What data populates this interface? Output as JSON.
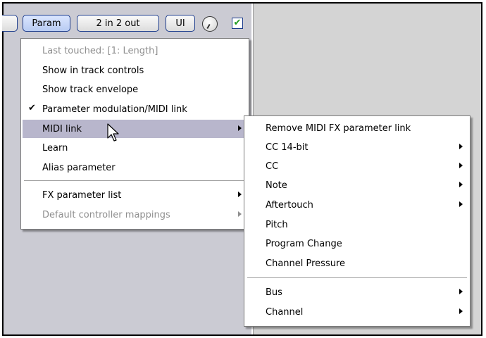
{
  "toolbar": {
    "param_label": "Param",
    "io_label": "2 in 2 out",
    "ui_label": "UI",
    "knob_icon": "knob-icon",
    "checkbox_mark": "✔"
  },
  "context_menu": {
    "last_touched": "Last touched: [1: Length]",
    "show_track_controls": "Show in track controls",
    "show_track_envelope": "Show track envelope",
    "param_modulation": "Parameter modulation/MIDI link",
    "param_modulation_check": "✔",
    "midi_link": "MIDI link",
    "learn": "Learn",
    "alias_parameter": "Alias parameter",
    "fx_parameter_list": "FX parameter list",
    "default_controller_mappings": "Default controller mappings"
  },
  "midi_submenu": {
    "remove_link": "Remove MIDI FX parameter link",
    "cc14": "CC 14-bit",
    "cc": "CC",
    "note": "Note",
    "aftertouch": "Aftertouch",
    "pitch": "Pitch",
    "program_change": "Program Change",
    "channel_pressure": "Channel Pressure",
    "bus": "Bus",
    "channel": "Channel"
  },
  "colors": {
    "highlight": "#b8b6cc",
    "panel": "#cbcbd3",
    "button_border": "#1b3b8c"
  }
}
